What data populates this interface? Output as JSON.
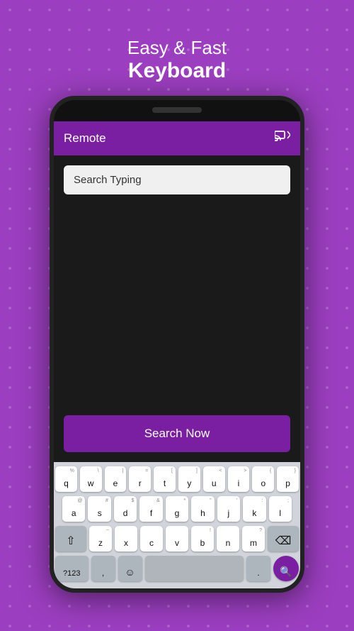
{
  "header": {
    "line1": "Easy & Fast",
    "line2": "Keyboard"
  },
  "appBar": {
    "title": "Remote",
    "castIcon": "⊟"
  },
  "searchBar": {
    "placeholder": "Search Typing",
    "value": "Search Typing"
  },
  "searchButton": {
    "label": "Search Now"
  },
  "keyboard": {
    "row1": [
      {
        "char": "q",
        "alt": "%"
      },
      {
        "char": "w",
        "alt": "\\"
      },
      {
        "char": "e",
        "alt": "|"
      },
      {
        "char": "r",
        "alt": "="
      },
      {
        "char": "t",
        "alt": "["
      },
      {
        "char": "y",
        "alt": "]"
      },
      {
        "char": "u",
        "alt": "<"
      },
      {
        "char": "i",
        "alt": ">"
      },
      {
        "char": "o",
        "alt": "{"
      },
      {
        "char": "p",
        "alt": "}"
      }
    ],
    "row2": [
      {
        "char": "a",
        "alt": "@"
      },
      {
        "char": "s",
        "alt": "#"
      },
      {
        "char": "d",
        "alt": "$"
      },
      {
        "char": "f",
        "alt": "&"
      },
      {
        "char": "g",
        "alt": "*"
      },
      {
        "char": "h",
        "alt": "\""
      },
      {
        "char": "j",
        "alt": "'"
      },
      {
        "char": "k",
        "alt": ":"
      },
      {
        "char": "l",
        "alt": ";"
      }
    ],
    "row3_left": "⇧",
    "row3": [
      {
        "char": "z",
        "alt": "~"
      },
      {
        "char": "x"
      },
      {
        "char": "c"
      },
      {
        "char": "v"
      },
      {
        "char": "b",
        "alt": "!"
      },
      {
        "char": "n"
      },
      {
        "char": "m",
        "alt": "?"
      }
    ],
    "row3_right": "⌫",
    "row4_num": "?123",
    "row4_comma": ",",
    "row4_emoji": "☺",
    "row4_period": ".",
    "row4_search": "🔍"
  }
}
